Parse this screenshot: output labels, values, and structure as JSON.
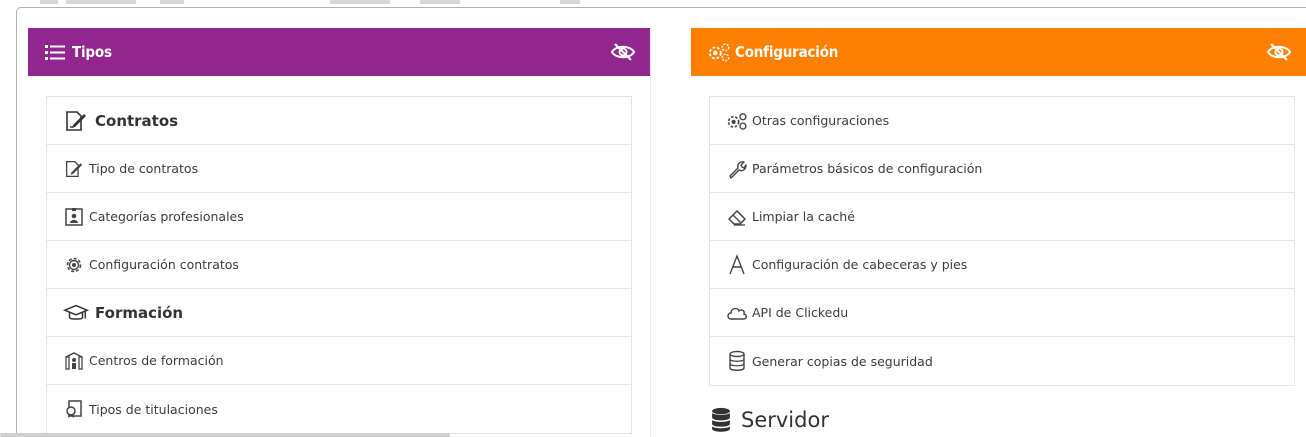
{
  "tipos_panel": {
    "title": "Tipos",
    "header_color": "#92278f",
    "items": [
      {
        "label": "Contratos",
        "kind": "section",
        "icon": "contract-icon"
      },
      {
        "label": "Tipo de contratos",
        "kind": "link",
        "icon": "contract-icon"
      },
      {
        "label": "Categorías profesionales",
        "kind": "link",
        "icon": "id-badge-icon"
      },
      {
        "label": "Configuración contratos",
        "kind": "link",
        "icon": "gear-icon"
      },
      {
        "label": "Formación",
        "kind": "section",
        "icon": "graduation-cap-icon"
      },
      {
        "label": "Centros de formación",
        "kind": "link",
        "icon": "school-building-icon"
      },
      {
        "label": "Tipos de titulaciones",
        "kind": "link",
        "icon": "certificate-icon"
      }
    ]
  },
  "config_panel": {
    "title": "Configuración",
    "header_color": "#ff8000",
    "items": [
      {
        "label": "Otras configuraciones",
        "icon": "gears-icon"
      },
      {
        "label": "Parámetros básicos de configuración",
        "icon": "wrench-icon"
      },
      {
        "label": "Limpiar la caché",
        "icon": "eraser-icon"
      },
      {
        "label": "Configuración de cabeceras y pies",
        "icon": "letter-a-icon"
      },
      {
        "label": "API de Clickedu",
        "icon": "cloud-icon"
      },
      {
        "label": "Generar copias de seguridad",
        "icon": "database-icon"
      }
    ]
  },
  "servidor": {
    "title": "Servidor",
    "icon": "database-icon"
  }
}
